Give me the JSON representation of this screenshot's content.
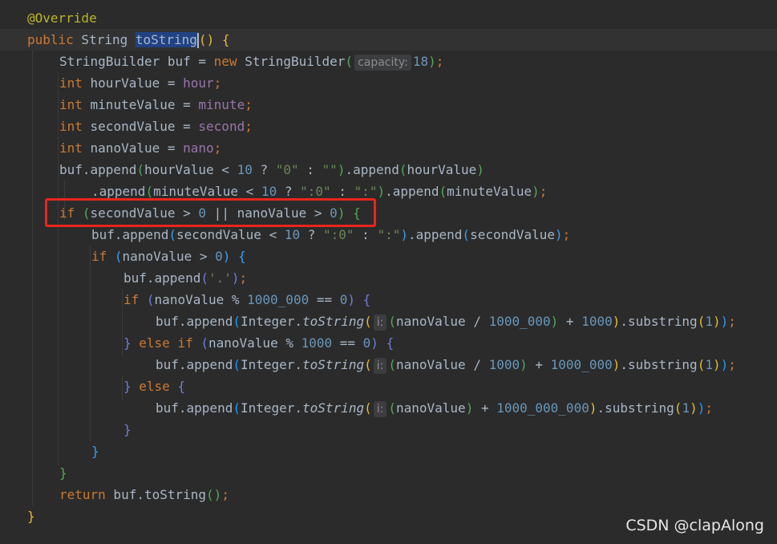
{
  "colors": {
    "background": "#2b2b2b",
    "keyword": "#cc7832",
    "annotation": "#bbb529",
    "number": "#6897bb",
    "string": "#6a8759",
    "field": "#9876aa",
    "highlight_box": "#e8261d"
  },
  "watermark": "CSDN @clapAlong",
  "code_lines": [
    [
      {
        "t": "@Override",
        "c": "ann"
      }
    ],
    [
      {
        "t": "public",
        "c": "kw"
      },
      {
        "t": " String "
      },
      {
        "t": "toString",
        "c": "sel"
      },
      {
        "t": "caret",
        "c": "caret"
      },
      {
        "t": "(",
        "c": "b1"
      },
      {
        "t": ")",
        "c": "b1"
      },
      {
        "t": " "
      },
      {
        "t": "{",
        "c": "b1"
      }
    ],
    [
      {
        "t": "StringBuilder buf = "
      },
      {
        "t": "new",
        "c": "kw"
      },
      {
        "t": " StringBuilder"
      },
      {
        "t": "(",
        "c": "b2"
      },
      {
        "t": "capacity:",
        "c": "hint"
      },
      {
        "t": "18",
        "c": "num"
      },
      {
        "t": ")",
        "c": "b2"
      },
      {
        "t": ";",
        "c": "kw"
      }
    ],
    [
      {
        "t": "int",
        "c": "kw"
      },
      {
        "t": " hourValue = "
      },
      {
        "t": "hour",
        "c": "field"
      },
      {
        "t": ";",
        "c": "kw"
      }
    ],
    [
      {
        "t": "int",
        "c": "kw"
      },
      {
        "t": " minuteValue = "
      },
      {
        "t": "minute",
        "c": "field"
      },
      {
        "t": ";",
        "c": "kw"
      }
    ],
    [
      {
        "t": "int",
        "c": "kw"
      },
      {
        "t": " secondValue = "
      },
      {
        "t": "second",
        "c": "field"
      },
      {
        "t": ";",
        "c": "kw"
      }
    ],
    [
      {
        "t": "int",
        "c": "kw"
      },
      {
        "t": " nanoValue = "
      },
      {
        "t": "nano",
        "c": "field"
      },
      {
        "t": ";",
        "c": "kw"
      }
    ],
    [
      {
        "t": "buf.append"
      },
      {
        "t": "(",
        "c": "b2"
      },
      {
        "t": "hourValue < "
      },
      {
        "t": "10",
        "c": "num"
      },
      {
        "t": " ? "
      },
      {
        "t": "\"0\"",
        "c": "str"
      },
      {
        "t": " : "
      },
      {
        "t": "\"\"",
        "c": "str"
      },
      {
        "t": ")",
        "c": "b2"
      },
      {
        "t": ".append"
      },
      {
        "t": "(",
        "c": "b2"
      },
      {
        "t": "hourValue"
      },
      {
        "t": ")",
        "c": "b2"
      }
    ],
    [
      {
        "t": ".append"
      },
      {
        "t": "(",
        "c": "b2"
      },
      {
        "t": "minuteValue < "
      },
      {
        "t": "10",
        "c": "num"
      },
      {
        "t": " ? "
      },
      {
        "t": "\":0\"",
        "c": "str"
      },
      {
        "t": " : "
      },
      {
        "t": "\":\"",
        "c": "str"
      },
      {
        "t": ")",
        "c": "b2"
      },
      {
        "t": ".append"
      },
      {
        "t": "(",
        "c": "b2"
      },
      {
        "t": "minuteValue"
      },
      {
        "t": ")",
        "c": "b2"
      },
      {
        "t": ";",
        "c": "kw"
      }
    ],
    [
      {
        "t": "if",
        "c": "kw"
      },
      {
        "t": " "
      },
      {
        "t": "(",
        "c": "b2"
      },
      {
        "t": "secondValue > "
      },
      {
        "t": "0",
        "c": "num"
      },
      {
        "t": " || nanoValue > "
      },
      {
        "t": "0",
        "c": "num"
      },
      {
        "t": ")",
        "c": "b2"
      },
      {
        "t": " "
      },
      {
        "t": "{",
        "c": "b2"
      }
    ],
    [
      {
        "t": "buf.append"
      },
      {
        "t": "(",
        "c": "b3"
      },
      {
        "t": "secondValue < "
      },
      {
        "t": "10",
        "c": "num"
      },
      {
        "t": " ? "
      },
      {
        "t": "\":0\"",
        "c": "str"
      },
      {
        "t": " : "
      },
      {
        "t": "\":\"",
        "c": "str"
      },
      {
        "t": ")",
        "c": "b3"
      },
      {
        "t": ".append"
      },
      {
        "t": "(",
        "c": "b3"
      },
      {
        "t": "secondValue"
      },
      {
        "t": ")",
        "c": "b3"
      },
      {
        "t": ";",
        "c": "kw"
      }
    ],
    [
      {
        "t": "if",
        "c": "kw"
      },
      {
        "t": " "
      },
      {
        "t": "(",
        "c": "b3"
      },
      {
        "t": "nanoValue > "
      },
      {
        "t": "0",
        "c": "num"
      },
      {
        "t": ")",
        "c": "b3"
      },
      {
        "t": " "
      },
      {
        "t": "{",
        "c": "b3"
      }
    ],
    [
      {
        "t": "buf.append"
      },
      {
        "t": "(",
        "c": "b4"
      },
      {
        "t": "'.'",
        "c": "str"
      },
      {
        "t": ")",
        "c": "b4"
      },
      {
        "t": ";",
        "c": "kw"
      }
    ],
    [
      {
        "t": "if",
        "c": "kw"
      },
      {
        "t": " "
      },
      {
        "t": "(",
        "c": "b4"
      },
      {
        "t": "nanoValue % "
      },
      {
        "t": "1000_000",
        "c": "num"
      },
      {
        "t": " == "
      },
      {
        "t": "0",
        "c": "num"
      },
      {
        "t": ")",
        "c": "b4"
      },
      {
        "t": " "
      },
      {
        "t": "{",
        "c": "b4"
      }
    ],
    [
      {
        "t": "buf.append"
      },
      {
        "t": "(",
        "c": "b5"
      },
      {
        "t": "Integer."
      },
      {
        "t": "toString",
        "c": "static"
      },
      {
        "t": "(",
        "c": "b1"
      },
      {
        "t": "i:",
        "c": "hint"
      },
      {
        "t": "(",
        "c": "b2"
      },
      {
        "t": "nanoValue / "
      },
      {
        "t": "1000_000",
        "c": "num"
      },
      {
        "t": ")",
        "c": "b2"
      },
      {
        "t": " + "
      },
      {
        "t": "1000",
        "c": "num"
      },
      {
        "t": ")",
        "c": "b1"
      },
      {
        "t": ".substring"
      },
      {
        "t": "(",
        "c": "b1"
      },
      {
        "t": "1",
        "c": "num"
      },
      {
        "t": ")",
        "c": "b1"
      },
      {
        "t": ")",
        "c": "b5"
      },
      {
        "t": ";",
        "c": "kw"
      }
    ],
    [
      {
        "t": "}",
        "c": "b4"
      },
      {
        "t": " "
      },
      {
        "t": "else",
        "c": "kw"
      },
      {
        "t": " "
      },
      {
        "t": "if",
        "c": "kw"
      },
      {
        "t": " "
      },
      {
        "t": "(",
        "c": "b4"
      },
      {
        "t": "nanoValue % "
      },
      {
        "t": "1000",
        "c": "num"
      },
      {
        "t": " == "
      },
      {
        "t": "0",
        "c": "num"
      },
      {
        "t": ")",
        "c": "b4"
      },
      {
        "t": " "
      },
      {
        "t": "{",
        "c": "b4"
      }
    ],
    [
      {
        "t": "buf.append"
      },
      {
        "t": "(",
        "c": "b5"
      },
      {
        "t": "Integer."
      },
      {
        "t": "toString",
        "c": "static"
      },
      {
        "t": "(",
        "c": "b1"
      },
      {
        "t": "i:",
        "c": "hint"
      },
      {
        "t": "(",
        "c": "b2"
      },
      {
        "t": "nanoValue / "
      },
      {
        "t": "1000",
        "c": "num"
      },
      {
        "t": ")",
        "c": "b2"
      },
      {
        "t": " + "
      },
      {
        "t": "1000_000",
        "c": "num"
      },
      {
        "t": ")",
        "c": "b1"
      },
      {
        "t": ".substring"
      },
      {
        "t": "(",
        "c": "b1"
      },
      {
        "t": "1",
        "c": "num"
      },
      {
        "t": ")",
        "c": "b1"
      },
      {
        "t": ")",
        "c": "b5"
      },
      {
        "t": ";",
        "c": "kw"
      }
    ],
    [
      {
        "t": "}",
        "c": "b4"
      },
      {
        "t": " "
      },
      {
        "t": "else",
        "c": "kw"
      },
      {
        "t": " "
      },
      {
        "t": "{",
        "c": "b4"
      }
    ],
    [
      {
        "t": "buf.append"
      },
      {
        "t": "(",
        "c": "b5"
      },
      {
        "t": "Integer."
      },
      {
        "t": "toString",
        "c": "static"
      },
      {
        "t": "(",
        "c": "b1"
      },
      {
        "t": "i:",
        "c": "hint"
      },
      {
        "t": "(",
        "c": "b2"
      },
      {
        "t": "nanoValue"
      },
      {
        "t": ")",
        "c": "b2"
      },
      {
        "t": " + "
      },
      {
        "t": "1000_000_000",
        "c": "num"
      },
      {
        "t": ")",
        "c": "b1"
      },
      {
        "t": ".substring"
      },
      {
        "t": "(",
        "c": "b1"
      },
      {
        "t": "1",
        "c": "num"
      },
      {
        "t": ")",
        "c": "b1"
      },
      {
        "t": ")",
        "c": "b5"
      },
      {
        "t": ";",
        "c": "kw"
      }
    ],
    [
      {
        "t": "}",
        "c": "b4"
      }
    ],
    [
      {
        "t": "}",
        "c": "b3"
      }
    ],
    [
      {
        "t": "}",
        "c": "b2"
      }
    ],
    [
      {
        "t": "return",
        "c": "kw"
      },
      {
        "t": " buf.toString"
      },
      {
        "t": "(",
        "c": "b2"
      },
      {
        "t": ")",
        "c": "b2"
      },
      {
        "t": ";",
        "c": "kw"
      }
    ],
    [
      {
        "t": "}",
        "c": "b1"
      }
    ]
  ]
}
